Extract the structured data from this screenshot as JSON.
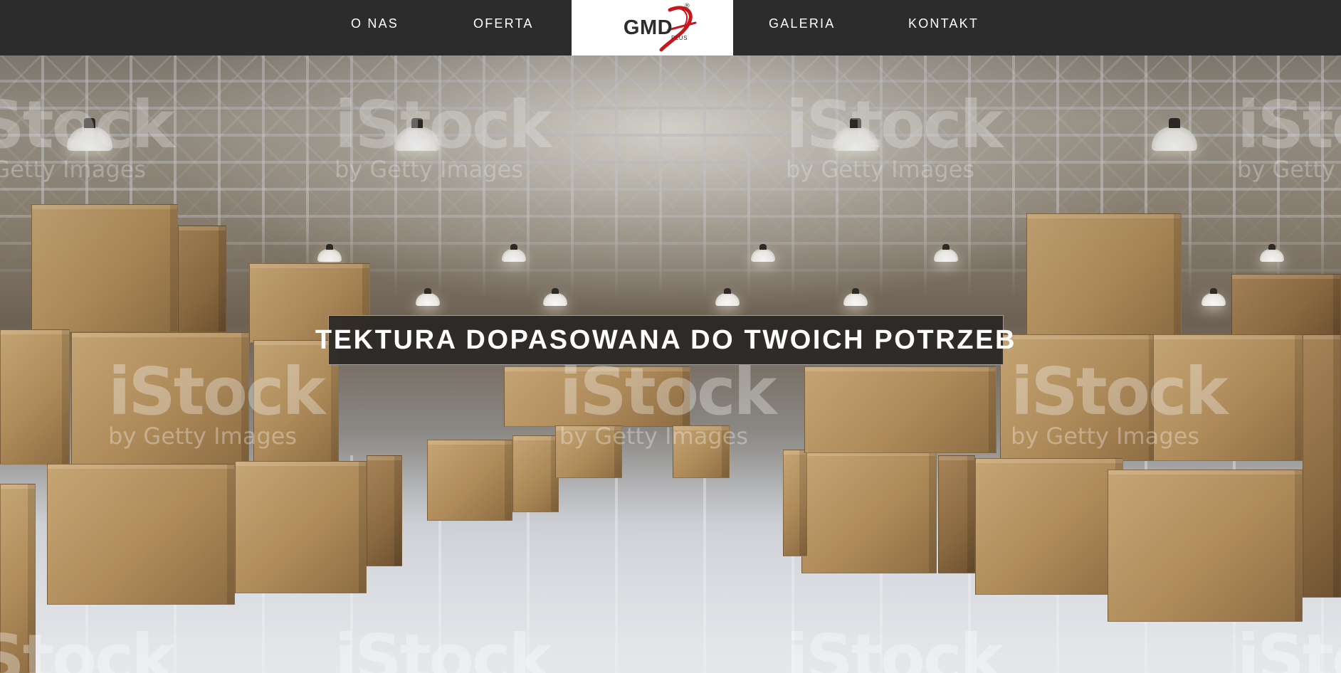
{
  "nav": {
    "items": [
      {
        "label": "O NAS"
      },
      {
        "label": "OFERTA"
      },
      {
        "label": "GALERIA"
      },
      {
        "label": "KONTAKT"
      }
    ],
    "logo": {
      "text": "GMD",
      "suffix": "PLUS",
      "registered_mark": "®",
      "accent_color": "#c8161d",
      "icon": "gmd-plus-logo-icon"
    }
  },
  "hero": {
    "headline": "TEKTURA DOPASOWANA DO TWOICH POTRZEB",
    "watermark": {
      "main": "iStock",
      "sub": "by Getty Images"
    }
  },
  "colors": {
    "navbar_bg": "#2c2c2c",
    "nav_text": "#ffffff",
    "logo_bg": "#ffffff",
    "headline_bg": "#282624"
  }
}
